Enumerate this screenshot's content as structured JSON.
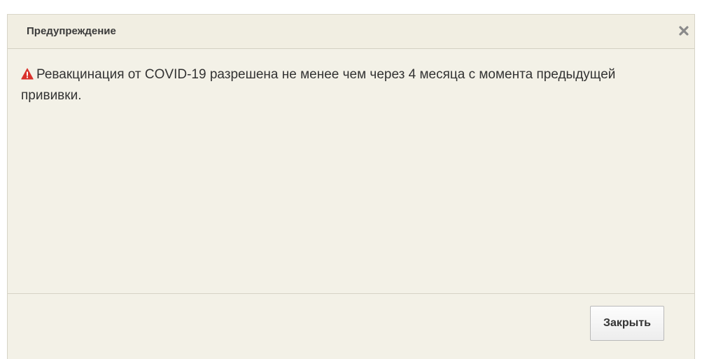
{
  "dialog": {
    "title": "Предупреждение",
    "close_icon": "close-x-icon",
    "message_icon": "warning-triangle-icon",
    "message": "Ревакцинация от COVID-19 разрешена не менее чем через 4 месяца с момента предыдущей прививки.",
    "close_button_label": "Закрыть"
  },
  "colors": {
    "background": "#f3f1e7",
    "warning_icon": "#d9312b",
    "text": "#333333"
  }
}
